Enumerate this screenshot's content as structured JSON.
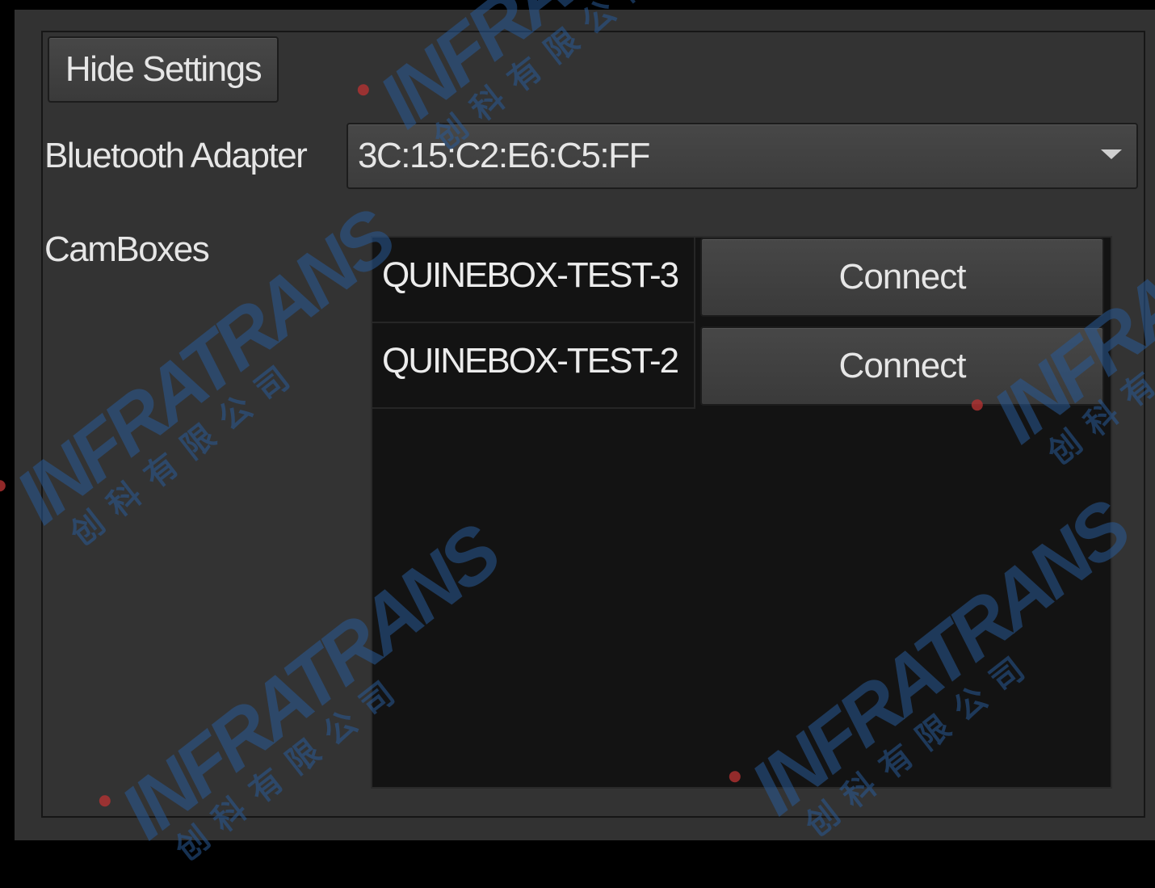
{
  "settings": {
    "hide_button_label": "Hide Settings",
    "bluetooth_label": "Bluetooth Adapter",
    "bluetooth_selected": "3C:15:C2:E6:C5:FF",
    "camboxes_label": "CamBoxes"
  },
  "camboxes": [
    {
      "name": "QUINEBOX-TEST-3",
      "action_label": "Connect"
    },
    {
      "name": "QUINEBOX-TEST-2",
      "action_label": "Connect"
    }
  ],
  "watermark": {
    "brand": "INFRATRANS",
    "tagline": "创科有限公司"
  },
  "colors": {
    "window_bg": "#323232",
    "list_bg": "#131313",
    "button_bg": "#424242",
    "text": "#e6e6e6",
    "watermark": "#285a96"
  },
  "icons": {
    "dropdown": "chevron-down-icon"
  }
}
